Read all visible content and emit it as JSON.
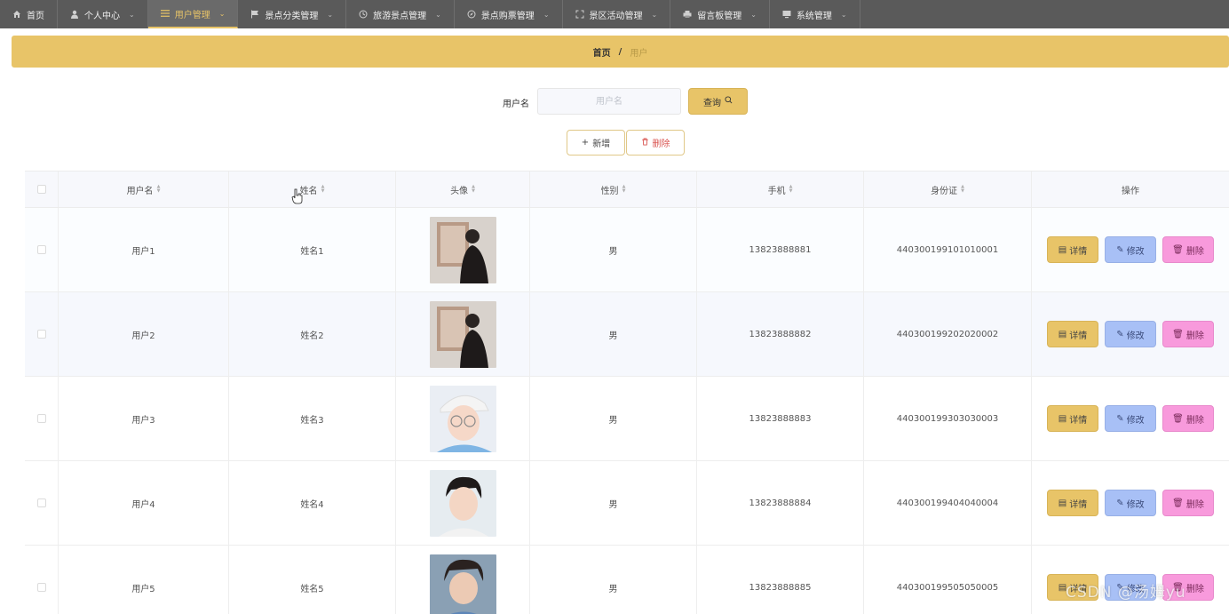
{
  "nav": {
    "items": [
      {
        "label": "首页",
        "icon": "home-icon"
      },
      {
        "label": "个人中心",
        "icon": "user-icon"
      },
      {
        "label": "用户管理",
        "icon": "list-icon"
      },
      {
        "label": "景点分类管理",
        "icon": "flag-icon"
      },
      {
        "label": "旅游景点管理",
        "icon": "clock-icon"
      },
      {
        "label": "景点购票管理",
        "icon": "compass-icon"
      },
      {
        "label": "景区活动管理",
        "icon": "fullscreen-icon"
      },
      {
        "label": "留言板管理",
        "icon": "printer-icon"
      },
      {
        "label": "系统管理",
        "icon": "monitor-icon"
      }
    ],
    "active_index": 2
  },
  "breadcrumb": {
    "home": "首页",
    "separator": "/",
    "current": "用户"
  },
  "search": {
    "label": "用户名",
    "placeholder": "用户名",
    "value": "",
    "button": "查询"
  },
  "actions": {
    "add": "新增",
    "delete": "删除"
  },
  "table": {
    "headers": [
      "用户名",
      "姓名",
      "头像",
      "性别",
      "手机",
      "身份证",
      "操作"
    ],
    "rows": [
      {
        "username": "用户1",
        "name": "姓名1",
        "gender": "男",
        "phone": "13823888881",
        "id_card": "440300199101010001"
      },
      {
        "username": "用户2",
        "name": "姓名2",
        "gender": "男",
        "phone": "13823888882",
        "id_card": "440300199202020002"
      },
      {
        "username": "用户3",
        "name": "姓名3",
        "gender": "男",
        "phone": "13823888883",
        "id_card": "440300199303030003"
      },
      {
        "username": "用户4",
        "name": "姓名4",
        "gender": "男",
        "phone": "13823888884",
        "id_card": "440300199404040004"
      },
      {
        "username": "用户5",
        "name": "姓名5",
        "gender": "男",
        "phone": "13823888885",
        "id_card": "440300199505050005"
      }
    ],
    "row_actions": {
      "detail": "详情",
      "edit": "修改",
      "delete": "删除"
    }
  },
  "watermark": "CSDN @汤姆yu",
  "colors": {
    "accent": "#e8c468",
    "nav_bg": "#5a5a5a",
    "edit": "#a8c0f6",
    "delete": "#f89adc"
  }
}
